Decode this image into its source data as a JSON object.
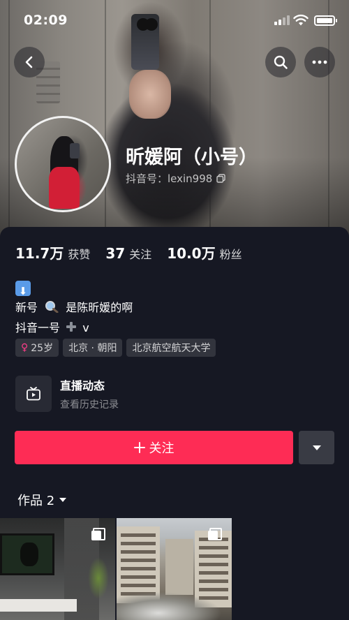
{
  "status_bar": {
    "time": "02:09"
  },
  "profile": {
    "name": "昕媛阿（小号）",
    "douyin_id": "抖音号：lexin998"
  },
  "stats": [
    {
      "value": "11.7万",
      "label": "获赞"
    },
    {
      "value": "37",
      "label": "关注"
    },
    {
      "value": "10.0万",
      "label": "粉丝"
    }
  ],
  "bio": {
    "line2_prefix": "新号",
    "line2_suffix": "是陈昕媛的啊",
    "line3_prefix": "抖音一号",
    "line3_suffix": "v"
  },
  "tags": {
    "age": "25岁",
    "location": "北京 · 朝阳",
    "school": "北京航空航天大学"
  },
  "live": {
    "title": "直播动态",
    "subtitle": "查看历史记录"
  },
  "follow_button": {
    "label": "关注"
  },
  "works_tab": {
    "label": "作品 2"
  },
  "colors": {
    "accent": "#fe2c55",
    "background": "#161823",
    "female": "#ff3e8a"
  }
}
